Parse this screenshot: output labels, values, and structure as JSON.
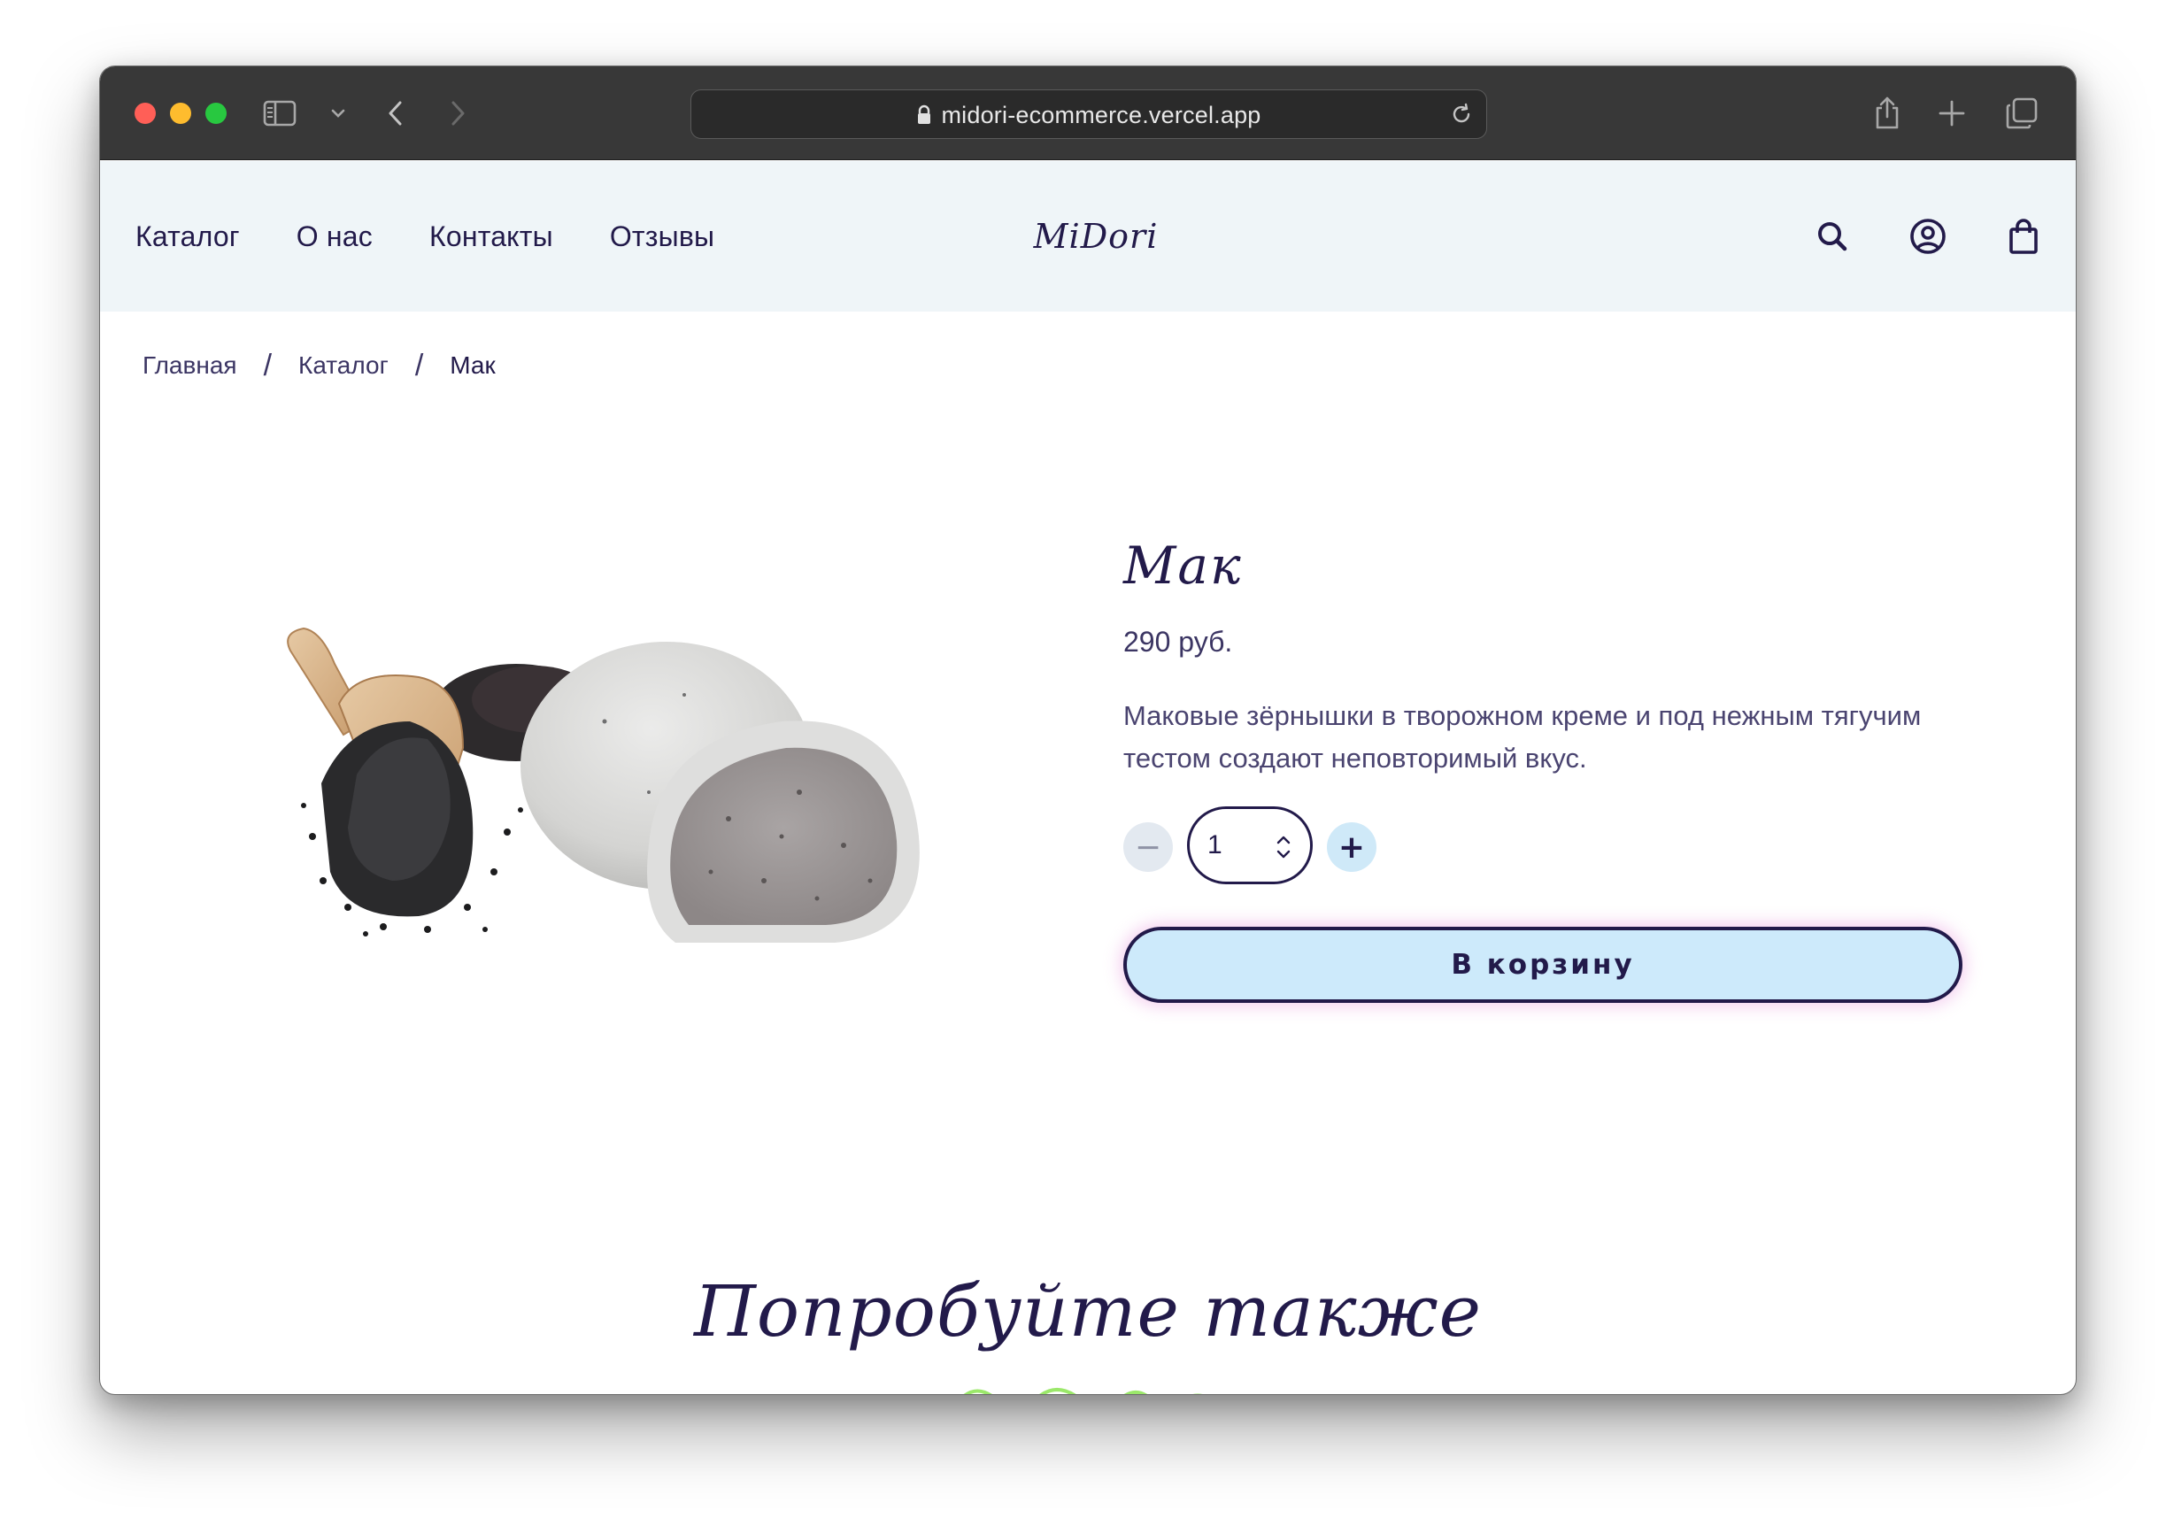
{
  "browser": {
    "url": "midori-ecommerce.vercel.app"
  },
  "header": {
    "nav": [
      "Каталог",
      "О нас",
      "Контакты",
      "Отзывы"
    ],
    "logo": "MiDori",
    "icons": [
      "search-icon",
      "account-icon",
      "shopping-bag-icon"
    ]
  },
  "breadcrumb": {
    "items": [
      "Главная",
      "Каталог",
      "Мак"
    ],
    "separator": "/"
  },
  "product": {
    "title": "Мак",
    "price": "290 руб.",
    "description": "Маковые зёрнышки в творожном креме и под нежным тягучим тестом создают неповторимый вкус.",
    "quantity": "1",
    "minus_label": "−",
    "plus_label": "+",
    "add_to_cart": "В корзину"
  },
  "related": {
    "title": "Попробуйте также"
  },
  "colors": {
    "brand_dark": "#221a4a",
    "header_bg": "#eff5f8",
    "button_bg": "#cdeafb",
    "chrome_bg": "#383838"
  }
}
